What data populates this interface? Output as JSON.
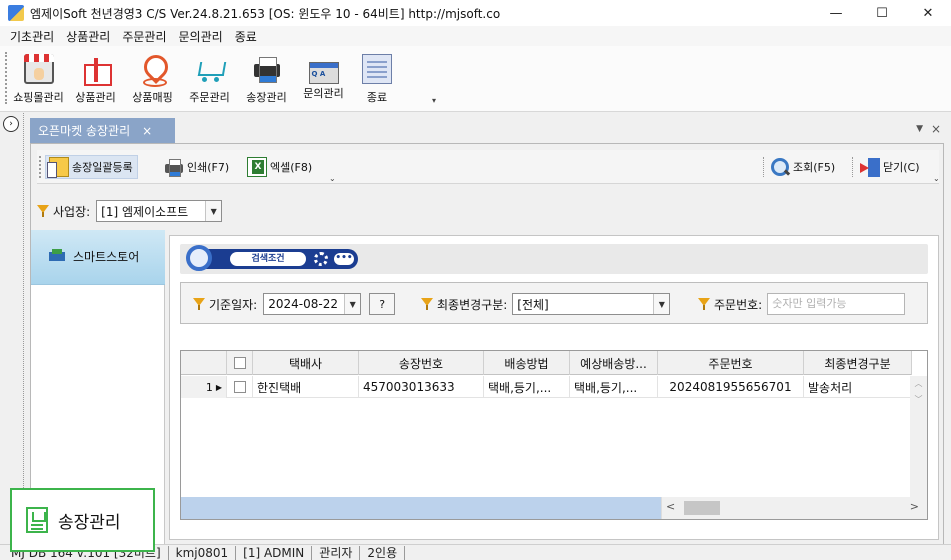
{
  "window": {
    "title": "엠제이Soft 천년경영3 C/S  Ver.24.8.21.653  [OS: 윈도우 10 - 64비트]   http://mjsoft.co",
    "minimize": "—",
    "maximize": "☐",
    "close": "✕"
  },
  "menu": [
    "기초관리",
    "상품관리",
    "주문관리",
    "문의관리",
    "종료"
  ],
  "toolbar": [
    {
      "label": "쇼핑몰관리",
      "icon": "shop-icon"
    },
    {
      "label": "상품관리",
      "icon": "gift-icon"
    },
    {
      "label": "상품매핑",
      "icon": "map-pin-icon"
    },
    {
      "label": "주문관리",
      "icon": "cart-icon"
    },
    {
      "label": "송장관리",
      "icon": "printer-icon"
    },
    {
      "label": "문의관리",
      "icon": "qa-icon"
    },
    {
      "label": "종료",
      "icon": "exit-icon"
    }
  ],
  "collapse_glyph": "›",
  "tabs": [
    {
      "label": "오픈마켓 송장관리",
      "close": "×"
    }
  ],
  "tab_menu_glyph": "▼",
  "tab_close_glyph": "×",
  "subtoolbar": {
    "bulk_register": "송장일괄등록",
    "print": "인쇄(F7)",
    "excel": "엑셀(F8)",
    "search": "조회(F5)",
    "close": "닫기(C)",
    "more": "⌄"
  },
  "business": {
    "label": "사업장:",
    "value": "[1] 엠제이소프트"
  },
  "left_nav": [
    {
      "label": "스마트스토어",
      "icon": "store-icon"
    }
  ],
  "search_header": {
    "label": "검색조건",
    "more": "•••"
  },
  "criteria": {
    "date_label": "기준일자:",
    "date_value": "2024-08-22",
    "help_btn": "?",
    "change_type_label": "최종변경구분:",
    "change_type_value": "[전체]",
    "order_no_label": "주문번호:",
    "order_no_placeholder": "숫자만 입력가능"
  },
  "grid": {
    "columns": [
      "",
      "",
      "택배사",
      "송장번호",
      "배송방법",
      "예상배송방...",
      "주문번호",
      "최종변경구분"
    ],
    "rows": [
      {
        "num": "1",
        "marker": "▶",
        "courier": "한진택배",
        "invoice": "457003013633",
        "method": "택배,등기,...",
        "expected": "택배,등기,...",
        "order_no": "2024081955656701",
        "change": "발송처리"
      }
    ],
    "scroll_up": "︿",
    "scroll_down": "﹀",
    "scroll_left": "<",
    "scroll_right": ">"
  },
  "status": [
    "MJ DB 164 v:101 [32비트]",
    "kmj0801",
    "[1] ADMIN",
    "관리자",
    "2인용"
  ],
  "badge": {
    "label": "송장관리"
  },
  "colors": {
    "accent": "#3cb44b",
    "tab_active": "#8aa4c8",
    "nav_selected": "#a9d4ec",
    "grid_hscroll": "#bcd2ec"
  }
}
